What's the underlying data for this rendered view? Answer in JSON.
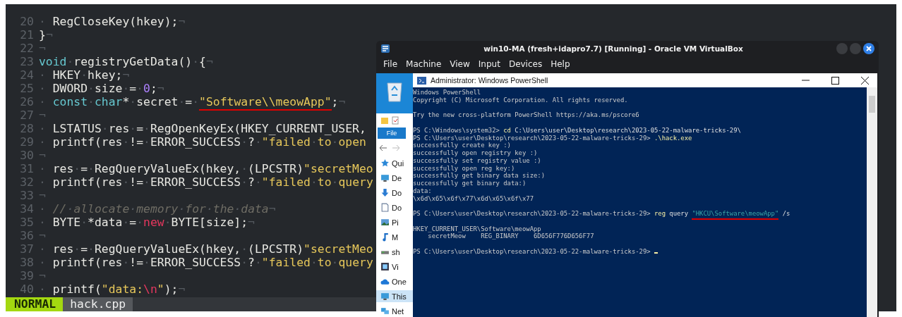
{
  "editor": {
    "lines": [
      {
        "number": "20",
        "tokens": [
          {
            "text": "· RegCloseKey(hkey);¬",
            "kind": "plain"
          }
        ]
      },
      {
        "number": "21",
        "tokens": [
          {
            "text": "}¬",
            "kind": "plain"
          }
        ]
      },
      {
        "number": "22",
        "tokens": [
          {
            "text": "¬",
            "kind": "plain"
          }
        ]
      },
      {
        "number": "23",
        "tokens": [
          {
            "text": "void",
            "kind": "type"
          },
          {
            "text": "·registryGetData()·{¬",
            "kind": "plain"
          }
        ]
      },
      {
        "number": "24",
        "tokens": [
          {
            "text": "· HKEY·hkey;¬",
            "kind": "plain"
          }
        ]
      },
      {
        "number": "25",
        "tokens": [
          {
            "text": "· DWORD·size·=·",
            "kind": "plain"
          },
          {
            "text": "0",
            "kind": "number"
          },
          {
            "text": ";¬",
            "kind": "plain"
          }
        ]
      },
      {
        "number": "26",
        "tokens": [
          {
            "text": "· ",
            "kind": "plain"
          },
          {
            "text": "const·char",
            "kind": "type"
          },
          {
            "text": "*·secret·=·",
            "kind": "plain"
          },
          {
            "text": "\"Software\\\\meowApp\"",
            "kind": "marked"
          },
          {
            "text": ";¬",
            "kind": "plain"
          }
        ]
      },
      {
        "number": "27",
        "tokens": [
          {
            "text": "¬",
            "kind": "plain"
          }
        ]
      },
      {
        "number": "28",
        "tokens": [
          {
            "text": "· LSTATUS·res·=·RegOpenKeyEx(HKEY_CURRENT_USER,",
            "kind": "plain"
          }
        ]
      },
      {
        "number": "29",
        "tokens": [
          {
            "text": "· printf(res·!=·ERROR_SUCCESS·?·",
            "kind": "plain"
          },
          {
            "text": "\"failed·to·open",
            "kind": "string"
          }
        ]
      },
      {
        "number": "30",
        "tokens": [
          {
            "text": "¬",
            "kind": "plain"
          }
        ]
      },
      {
        "number": "31",
        "tokens": [
          {
            "text": "· res·=·RegQueryValueEx(hkey,·(LPCSTR)",
            "kind": "plain"
          },
          {
            "text": "\"secretMeo",
            "kind": "string"
          }
        ]
      },
      {
        "number": "32",
        "tokens": [
          {
            "text": "· printf(res·!=·ERROR_SUCCESS·?·",
            "kind": "plain"
          },
          {
            "text": "\"failed·to·query",
            "kind": "string"
          }
        ]
      },
      {
        "number": "33",
        "tokens": [
          {
            "text": "¬",
            "kind": "plain"
          }
        ]
      },
      {
        "number": "34",
        "tokens": [
          {
            "text": "· ",
            "kind": "plain"
          },
          {
            "text": "//·allocate·memory·for·the·data",
            "kind": "comment"
          },
          {
            "text": "¬",
            "kind": "plain"
          }
        ]
      },
      {
        "number": "35",
        "tokens": [
          {
            "text": "· BYTE·*data·=·",
            "kind": "plain"
          },
          {
            "text": "new",
            "kind": "keyword"
          },
          {
            "text": "·BYTE[size];¬",
            "kind": "plain"
          }
        ]
      },
      {
        "number": "36",
        "tokens": [
          {
            "text": "¬",
            "kind": "plain"
          }
        ]
      },
      {
        "number": "37",
        "tokens": [
          {
            "text": "· res·=·RegQueryValueEx(hkey,·(LPCSTR)",
            "kind": "plain"
          },
          {
            "text": "\"secretMeo",
            "kind": "string"
          }
        ]
      },
      {
        "number": "38",
        "tokens": [
          {
            "text": "· printf(res·!=·ERROR_SUCCESS·?·",
            "kind": "plain"
          },
          {
            "text": "\"failed·to·query",
            "kind": "string"
          }
        ]
      },
      {
        "number": "39",
        "tokens": [
          {
            "text": "¬",
            "kind": "plain"
          }
        ]
      },
      {
        "number": "40",
        "tokens": [
          {
            "text": "· printf(",
            "kind": "plain"
          },
          {
            "text": "\"data:",
            "kind": "string"
          },
          {
            "text": "\\n",
            "kind": "escape"
          },
          {
            "text": "\"",
            "kind": "string"
          },
          {
            "text": ");¬",
            "kind": "plain"
          }
        ]
      }
    ],
    "status": {
      "mode": "NORMAL",
      "file": "hack.cpp"
    }
  },
  "virtualbox": {
    "title": "win10-MA (fresh+idapro7.7) [Running] - Oracle VM VirtualBox",
    "menu": [
      "File",
      "Machine",
      "View",
      "Input",
      "Devices",
      "Help"
    ],
    "explorer": {
      "ribbon_tab": "File",
      "items": [
        {
          "label": "Qui",
          "kind": "star",
          "selected": false
        },
        {
          "label": "De",
          "kind": "monitor",
          "selected": false
        },
        {
          "label": "Do",
          "kind": "download",
          "selected": false
        },
        {
          "label": "Do",
          "kind": "document",
          "selected": false
        },
        {
          "label": "Pi",
          "kind": "picture",
          "selected": false
        },
        {
          "label": "M",
          "kind": "music",
          "selected": false
        },
        {
          "label": "sh",
          "kind": "drive",
          "selected": false
        },
        {
          "label": "Vi",
          "kind": "film",
          "selected": false
        },
        {
          "label": "One",
          "kind": "cloud",
          "selected": false
        },
        {
          "label": "This",
          "kind": "monitor",
          "selected": true
        },
        {
          "label": "Net",
          "kind": "network",
          "selected": false
        }
      ]
    },
    "powershell": {
      "title": "Administrator: Windows PowerShell",
      "cursor": true,
      "lines": [
        {
          "kind": "text",
          "segments": [
            {
              "text": "Windows PowerShell",
              "kind": "out"
            }
          ]
        },
        {
          "kind": "text",
          "segments": [
            {
              "text": "Copyright (C) Microsoft Corporation. All rights reserved.",
              "kind": "out"
            }
          ]
        },
        {
          "kind": "blank"
        },
        {
          "kind": "text",
          "segments": [
            {
              "text": "Try the new cross-platform PowerShell https://aka.ms/pscore6",
              "kind": "out"
            }
          ]
        },
        {
          "kind": "blank"
        },
        {
          "kind": "text",
          "segments": [
            {
              "text": "PS C:\\Windows\\system32> ",
              "kind": "out"
            },
            {
              "text": "cd",
              "kind": "cmd"
            },
            {
              "text": " C:\\Users\\user\\Desktop\\research\\2023-05-22-malware-tricks-29\\",
              "kind": "arg"
            }
          ]
        },
        {
          "kind": "text",
          "segments": [
            {
              "text": "PS C:\\Users\\user\\Desktop\\research\\2023-05-22-malware-tricks-29> ",
              "kind": "out"
            },
            {
              "text": ".\\hack.exe",
              "kind": "cmd"
            }
          ]
        },
        {
          "kind": "text",
          "segments": [
            {
              "text": "successfully create key :)",
              "kind": "out"
            }
          ]
        },
        {
          "kind": "text",
          "segments": [
            {
              "text": "successfully open registry key :)",
              "kind": "out"
            }
          ]
        },
        {
          "kind": "text",
          "segments": [
            {
              "text": "successfully set registry value :)",
              "kind": "out"
            }
          ]
        },
        {
          "kind": "text",
          "segments": [
            {
              "text": "successfully open reg key:)",
              "kind": "out"
            }
          ]
        },
        {
          "kind": "text",
          "segments": [
            {
              "text": "successfully get binary data size:)",
              "kind": "out"
            }
          ]
        },
        {
          "kind": "text",
          "segments": [
            {
              "text": "successfully get binary data:)",
              "kind": "out"
            }
          ]
        },
        {
          "kind": "text",
          "segments": [
            {
              "text": "data:",
              "kind": "out"
            }
          ]
        },
        {
          "kind": "text",
          "segments": [
            {
              "text": "\\x6d\\x65\\x6f\\x77\\x6d\\x65\\x6f\\x77",
              "kind": "out"
            }
          ]
        },
        {
          "kind": "blank"
        },
        {
          "kind": "text",
          "segments": [
            {
              "text": "PS C:\\Users\\user\\Desktop\\research\\2023-05-22-malware-tricks-29> ",
              "kind": "out"
            },
            {
              "text": "reg",
              "kind": "cmd"
            },
            {
              "text": " query ",
              "kind": "arg"
            },
            {
              "text": "\"HKCU\\Software\\meowApp\"",
              "kind": "marked"
            },
            {
              "text": " /s",
              "kind": "arg"
            }
          ]
        },
        {
          "kind": "blank"
        },
        {
          "kind": "text",
          "segments": [
            {
              "text": "HKEY_CURRENT_USER\\Software\\meowApp",
              "kind": "out"
            }
          ]
        },
        {
          "kind": "text",
          "segments": [
            {
              "text": "    secretMeow    REG_BINARY    6D656F776D656F77",
              "kind": "out"
            }
          ]
        },
        {
          "kind": "blank"
        },
        {
          "kind": "text",
          "segments": [
            {
              "text": "PS C:\\Users\\user\\Desktop\\research\\2023-05-22-malware-tricks-29> ",
              "kind": "out"
            }
          ]
        }
      ]
    }
  }
}
